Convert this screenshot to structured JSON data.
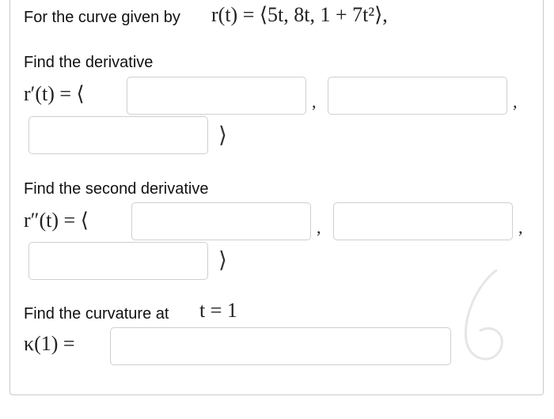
{
  "header": {
    "lead": "For the curve given by",
    "curve": "r(t) = ⟨5t, 8t, 1 + 7t²⟩,"
  },
  "derivative": {
    "prompt": "Find the derivative",
    "lhs": "r′(t) = ⟨",
    "fields": [
      "",
      "",
      ""
    ],
    "comma": ",",
    "close": "⟩"
  },
  "second_derivative": {
    "prompt": "Find the second derivative",
    "lhs": "r″(t) = ⟨",
    "fields": [
      "",
      "",
      ""
    ],
    "comma": ",",
    "close": "⟩"
  },
  "curvature": {
    "prompt": "Find the curvature at",
    "condition": "t = 1",
    "lhs": "κ(1) =",
    "field": ""
  },
  "colors": {
    "border": "#cfcfcf",
    "text": "#111111",
    "decoration": "#e6e6e6"
  },
  "icons": {
    "decoration": "handwritten-six-icon"
  }
}
